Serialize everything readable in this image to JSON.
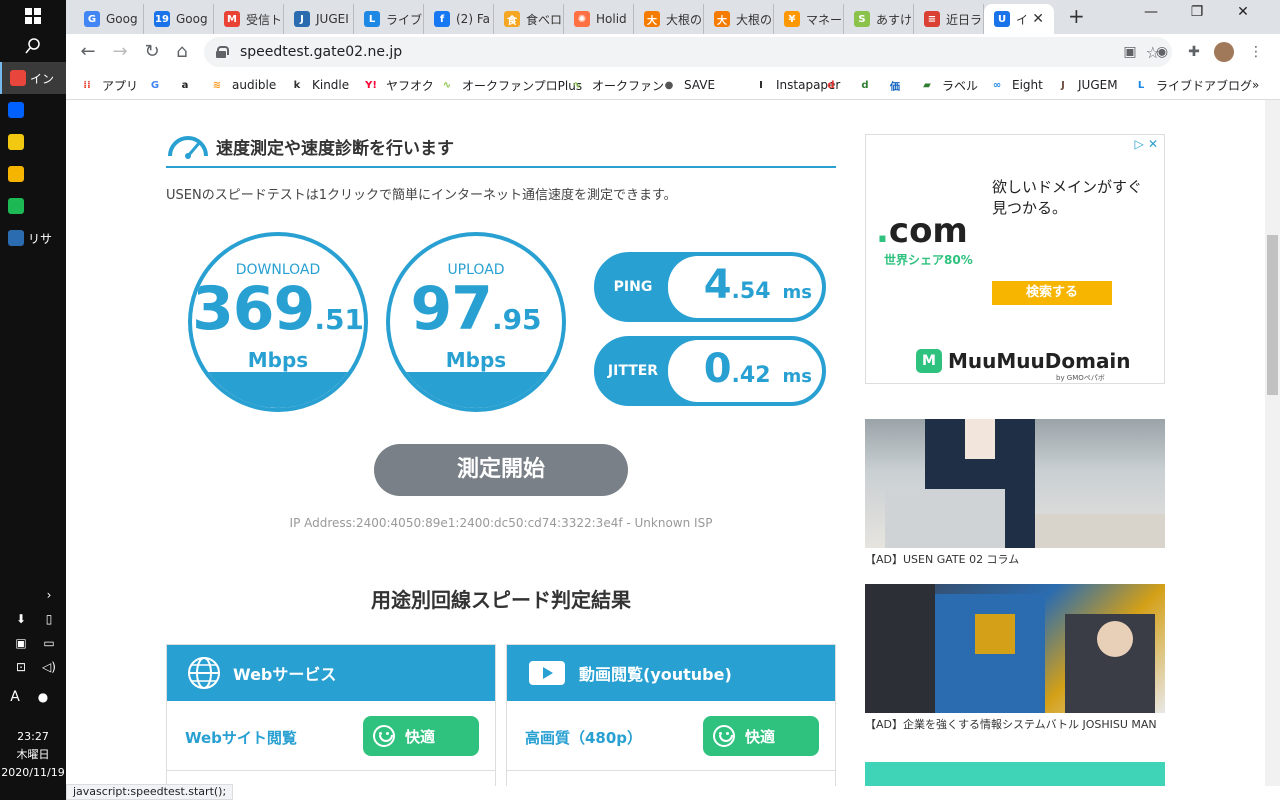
{
  "taskbar": {
    "apps": [
      {
        "label": "イン",
        "color": "#e8453c",
        "active": true
      },
      {
        "label": "",
        "color": "#0061fe"
      },
      {
        "label": "",
        "color": "#f2c811"
      },
      {
        "label": "",
        "color": "#f4b400"
      },
      {
        "label": "",
        "color": "#1db954"
      },
      {
        "label": "リサ",
        "color": "#2b6cb0"
      }
    ],
    "tray": {
      "time": "23:27",
      "weekday": "木曜日",
      "date": "2020/11/19",
      "ime": "A"
    }
  },
  "browser": {
    "tabs": [
      {
        "label": "Goog",
        "icon": "google-icon",
        "color": "#4285f4",
        "glyph": "G"
      },
      {
        "label": "Goog",
        "icon": "calendar-icon",
        "color": "#1a73e8",
        "glyph": "19"
      },
      {
        "label": "受信ト",
        "icon": "gmail-icon",
        "color": "#ea4335",
        "glyph": "M"
      },
      {
        "label": "JUGEI",
        "icon": "jugem-icon",
        "color": "#2b6cb0",
        "glyph": "J"
      },
      {
        "label": "ライブ",
        "icon": "livedoor-icon",
        "color": "#1e88e5",
        "glyph": "L"
      },
      {
        "label": "(2) Fa",
        "icon": "facebook-icon",
        "color": "#1877f2",
        "glyph": "f"
      },
      {
        "label": "食べロ",
        "icon": "tabelog-icon",
        "color": "#f5a623",
        "glyph": "食"
      },
      {
        "label": "Holid",
        "icon": "holiday-icon",
        "color": "#ff7043",
        "glyph": "✺"
      },
      {
        "label": "大根の",
        "icon": "cookpad-icon",
        "color": "#f57c00",
        "glyph": "大"
      },
      {
        "label": "大根の",
        "icon": "cookpad-icon",
        "color": "#f57c00",
        "glyph": "大"
      },
      {
        "label": "マネー",
        "icon": "money-icon",
        "color": "#ff9800",
        "glyph": "¥"
      },
      {
        "label": "あすけ",
        "icon": "asuke-icon",
        "color": "#8bc34a",
        "glyph": "S"
      },
      {
        "label": "近日ラ",
        "icon": "todoist-icon",
        "color": "#db4035",
        "glyph": "≡"
      },
      {
        "label": "イ",
        "icon": "usen-icon",
        "color": "#1a73e8",
        "glyph": "U",
        "active": true
      }
    ],
    "url": "speedtest.gate02.ne.jp",
    "bookmarks": [
      {
        "label": "アプリ",
        "icon": "apps-grid-icon",
        "color": "#ea4335",
        "glyph": "⁞⁞"
      },
      {
        "label": "",
        "icon": "google-icon",
        "color": "#4285f4",
        "glyph": "G"
      },
      {
        "label": "",
        "icon": "amazon-icon",
        "color": "#222222",
        "glyph": "a"
      },
      {
        "label": "audible",
        "icon": "audible-icon",
        "color": "#f7991c",
        "glyph": "≋"
      },
      {
        "label": "Kindle",
        "icon": "kindle-icon",
        "color": "#333333",
        "glyph": "k"
      },
      {
        "label": "ヤフオク",
        "icon": "yahoo-icon",
        "color": "#ff0033",
        "glyph": "Y!"
      },
      {
        "label": "オークファンプロPlus",
        "icon": "aucfan-icon",
        "color": "#8bc34a",
        "glyph": "∿"
      },
      {
        "label": "オークファン",
        "icon": "aucfan-icon",
        "color": "#8bc34a",
        "glyph": "∿"
      },
      {
        "label": "SAVE",
        "icon": "save-icon",
        "color": "#555555",
        "glyph": "●"
      },
      {
        "label": "Instapaper",
        "icon": "instapaper-icon",
        "color": "#222222",
        "glyph": "I"
      },
      {
        "label": "",
        "icon": "d-icon",
        "color": "#e53935",
        "glyph": "d"
      },
      {
        "label": "",
        "icon": "d-shop-icon",
        "color": "#2e7d32",
        "glyph": "d"
      },
      {
        "label": "",
        "icon": "kakaku-icon",
        "color": "#1565c0",
        "glyph": "価"
      },
      {
        "label": "ラベル",
        "icon": "label-icon",
        "color": "#2e7d32",
        "glyph": "▰"
      },
      {
        "label": "Eight",
        "icon": "eight-icon",
        "color": "#1e88e5",
        "glyph": "∞"
      },
      {
        "label": "JUGEM",
        "icon": "jugem-icon",
        "color": "#6d4c41",
        "glyph": "J"
      },
      {
        "label": "ライブドアブログ",
        "icon": "livedoor-icon",
        "color": "#1e88e5",
        "glyph": "L"
      }
    ],
    "status_text": "javascript:speedtest.start();"
  },
  "speedtest": {
    "heading": "速度測定や速度診断を行います",
    "intro": "USENのスピードテストは1クリックで簡単にインターネット通信速度を測定できます。",
    "download": {
      "label": "DOWNLOAD",
      "int": "369",
      "dec": ".51",
      "unit": "Mbps"
    },
    "upload": {
      "label": "UPLOAD",
      "int": "97",
      "dec": ".95",
      "unit": "Mbps"
    },
    "ping": {
      "label": "PING",
      "int": "4",
      "dec": ".54",
      "unit": "ms"
    },
    "jitter": {
      "label": "JITTER",
      "int": "0",
      "dec": ".42",
      "unit": "ms"
    },
    "start_button": "測定開始",
    "ip_line": "IP Address:2400:4050:89e1:2400:dc50:cd74:3322:3e4f - Unknown ISP",
    "results_title": "用途別回線スピード判定結果",
    "cards": [
      {
        "title": "Webサービス",
        "icon": "globe-icon",
        "row": "Webサイト閲覧",
        "verdict": "快適"
      },
      {
        "title": "動画閲覧(youtube)",
        "icon": "youtube-icon",
        "row": "高画質（480p）",
        "verdict": "快適"
      }
    ]
  },
  "ads": {
    "domain_ad": {
      "dotcom": "com",
      "share": "世界シェア80%",
      "message_line1": "欲しいドメインがすぐ",
      "message_line2": "見つかる。",
      "search": "検索する",
      "brand": "MuuMuuDomain",
      "byline": "by GMOペパボ"
    },
    "caption1": "【AD】USEN GATE 02 コラム",
    "caption2": "【AD】企業を強くする情報システムバトル JOSHISU MAN"
  }
}
